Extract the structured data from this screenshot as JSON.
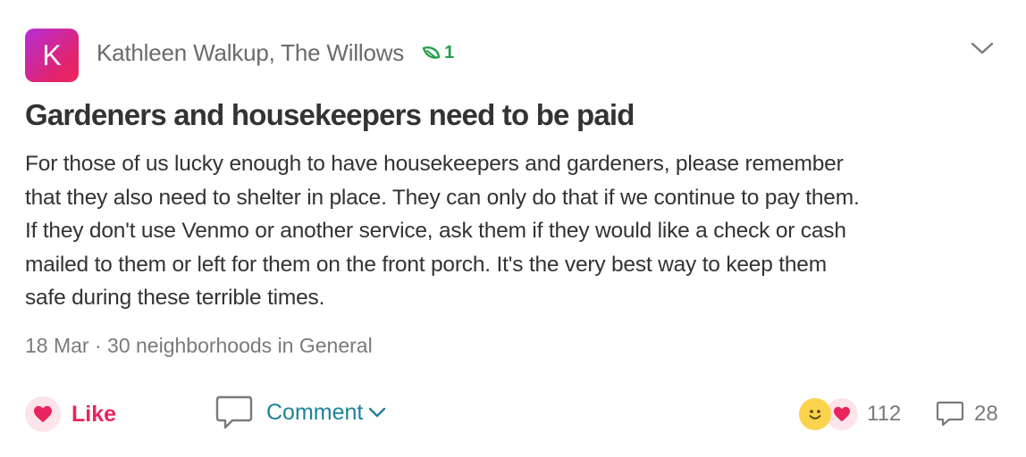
{
  "author": {
    "avatar_letter": "K",
    "name_line": "Kathleen Walkup, The Willows",
    "badge_count": "1"
  },
  "post": {
    "title": "Gardeners and housekeepers need to be paid",
    "body_lines": [
      "For those of us lucky enough to have housekeepers and gardeners, please remember",
      "that they also need to shelter in place. They can only do that if we continue to pay them.",
      "If they don't use Venmo or another service, ask them if they would like a check or cash",
      "mailed to them or left for them on the front porch. It's the very best way to keep them",
      "safe during these terrible times."
    ],
    "meta": "18 Mar · 30 neighborhoods in General"
  },
  "actions": {
    "like_label": "Like",
    "comment_label": "Comment",
    "reaction_count": "112",
    "comment_count": "28"
  },
  "icons": {
    "menu": "chevron-down-icon",
    "badge": "leaf-icon",
    "like": "heart-icon",
    "comment": "speech-bubble-icon",
    "reactions": [
      "smiley-icon",
      "heart-icon"
    ]
  },
  "colors": {
    "accent_like": "#e9245c",
    "accent_comment": "#1f8299",
    "badge_green": "#24a148"
  }
}
